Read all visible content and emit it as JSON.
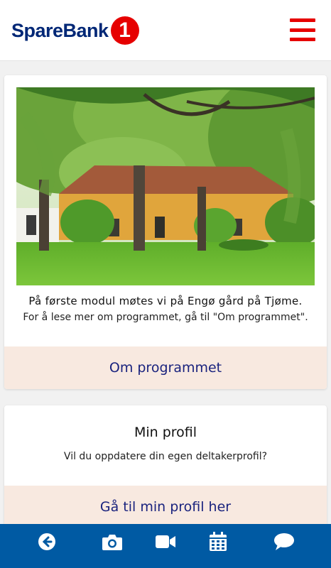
{
  "header": {
    "brand_text": "SpareBank",
    "brand_badge": "1",
    "menu_icon": "hamburger-menu-icon"
  },
  "program_card": {
    "image_description_icon": "photo",
    "caption_strong": "På første modul møtes vi på Engø gård på Tjøme.",
    "caption_text": "For å lese mer om programmet, gå til \"Om programmet\".",
    "button_label": "Om programmet"
  },
  "profile_card": {
    "title": "Min profil",
    "text": "Vil du oppdatere din egen deltakerprofil?",
    "button_label": "Gå til min profil her"
  },
  "bottom_nav": {
    "items": [
      {
        "icon": "back-arrow-icon"
      },
      {
        "icon": "camera-icon"
      },
      {
        "icon": "video-camera-icon"
      },
      {
        "icon": "calendar-icon"
      },
      {
        "icon": "chat-bubble-icon"
      }
    ]
  },
  "colors": {
    "brand_blue": "#002776",
    "brand_red": "#e60000",
    "nav_blue": "#005aa3",
    "button_bg": "#f8e9e0",
    "button_text": "#1a237e"
  }
}
